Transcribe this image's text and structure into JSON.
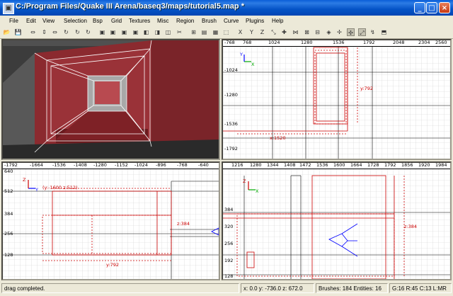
{
  "window": {
    "title": "C:/Program Files/Quake III Arena/baseq3/maps/tutorial5.map *",
    "controls": [
      "_",
      "□",
      "×"
    ]
  },
  "menu": [
    "File",
    "Edit",
    "View",
    "Selection",
    "Bsp",
    "Grid",
    "Textures",
    "Misc",
    "Region",
    "Brush",
    "Curve",
    "Plugins",
    "Help"
  ],
  "toolbar": {
    "buttons": [
      {
        "name": "open-icon",
        "glyph": "📂"
      },
      {
        "name": "save-icon",
        "glyph": "💾"
      },
      {
        "name": "flip-x-icon",
        "glyph": "⇔"
      },
      {
        "name": "flip-y-icon",
        "glyph": "⇕"
      },
      {
        "name": "flip-z-icon",
        "glyph": "⇔"
      },
      {
        "name": "rotate-x-icon",
        "glyph": "↻"
      },
      {
        "name": "rotate-y-icon",
        "glyph": "↻"
      },
      {
        "name": "rotate-z-icon",
        "glyph": "↻"
      },
      {
        "name": "select-complete-tall-icon",
        "glyph": "▣"
      },
      {
        "name": "select-touching-icon",
        "glyph": "▣"
      },
      {
        "name": "select-partial-tall-icon",
        "glyph": "▣"
      },
      {
        "name": "select-inside-icon",
        "glyph": "▣"
      },
      {
        "name": "csg-subtract-icon",
        "glyph": "◧"
      },
      {
        "name": "csg-merge-icon",
        "glyph": "◨"
      },
      {
        "name": "hollow-icon",
        "glyph": "◫"
      },
      {
        "name": "clipper-icon",
        "glyph": "✂"
      },
      {
        "name": "change-views-icon",
        "glyph": "⊞"
      },
      {
        "name": "texture-view-icon",
        "glyph": "▤"
      },
      {
        "name": "camera-icon",
        "glyph": "▦"
      },
      {
        "name": "cubic-clip-icon",
        "glyph": "⬚"
      },
      {
        "name": "view-x-icon",
        "glyph": "X"
      },
      {
        "name": "view-y-icon",
        "glyph": "Y"
      },
      {
        "name": "view-z-icon",
        "glyph": "Z"
      },
      {
        "name": "scale-icon",
        "glyph": "⤡"
      },
      {
        "name": "view-entity-icon",
        "glyph": "✚"
      },
      {
        "name": "patch-bend-icon",
        "glyph": "⋈"
      },
      {
        "name": "patch-insert-icon",
        "glyph": "⊠"
      },
      {
        "name": "patch-delete-icon",
        "glyph": "⊟"
      },
      {
        "name": "texture-lock-icon",
        "glyph": "◈"
      },
      {
        "name": "drag-edges-icon",
        "glyph": "✢"
      },
      {
        "name": "drag-vertices-icon",
        "glyph": "✣"
      },
      {
        "name": "show-bend-icon",
        "glyph": "⤢"
      },
      {
        "name": "free-rotate-icon",
        "glyph": "↯"
      },
      {
        "name": "patch-wireframe-icon",
        "glyph": "⬒"
      }
    ]
  },
  "viewports": {
    "xy": {
      "x_ticks": [
        "-768",
        "768",
        "1024",
        "1280",
        "1536",
        "1792",
        "2048",
        "2304",
        "2560"
      ],
      "y_ticks": [
        "-1024",
        "-1280",
        "-1536",
        "-1792"
      ],
      "labels": {
        "height": "y:792",
        "width": "x:1520"
      },
      "axis": {
        "h": "X",
        "v": "Y"
      }
    },
    "yz": {
      "x_ticks": [
        "-1792",
        "-1664",
        "-1536",
        "-1408",
        "-1280",
        "-1152",
        "-1024",
        "-896",
        "-768",
        "-640"
      ],
      "y_ticks": [
        "640",
        "512",
        "384",
        "256",
        "128"
      ],
      "labels": {
        "pos": "(y:-1600 z:512)",
        "height": "z:384",
        "width": "y:792"
      },
      "axis": {
        "h": "Y",
        "v": "Z"
      }
    },
    "xz": {
      "x_ticks": [
        "1216",
        "1280",
        "1344",
        "1408",
        "1472",
        "1536",
        "1600",
        "1664",
        "1728",
        "1792",
        "1856",
        "1920",
        "1984"
      ],
      "y_ticks": [
        "384",
        "320",
        "256",
        "192",
        "128"
      ],
      "labels": {
        "height": "z:384"
      },
      "axis": {
        "h": "X",
        "v": "Z"
      }
    }
  },
  "status": {
    "message": "drag completed.",
    "coords": "x: 0.0  y: -736.0  z: 672.0",
    "counts": "Brushes: 184 Entities: 16",
    "grid": "G:16 R:45 C:13 L:MR"
  },
  "colors": {
    "brush_red": "#cc0000",
    "wall_red": "#8b2a2f",
    "camera_blue": "#0000ff"
  }
}
